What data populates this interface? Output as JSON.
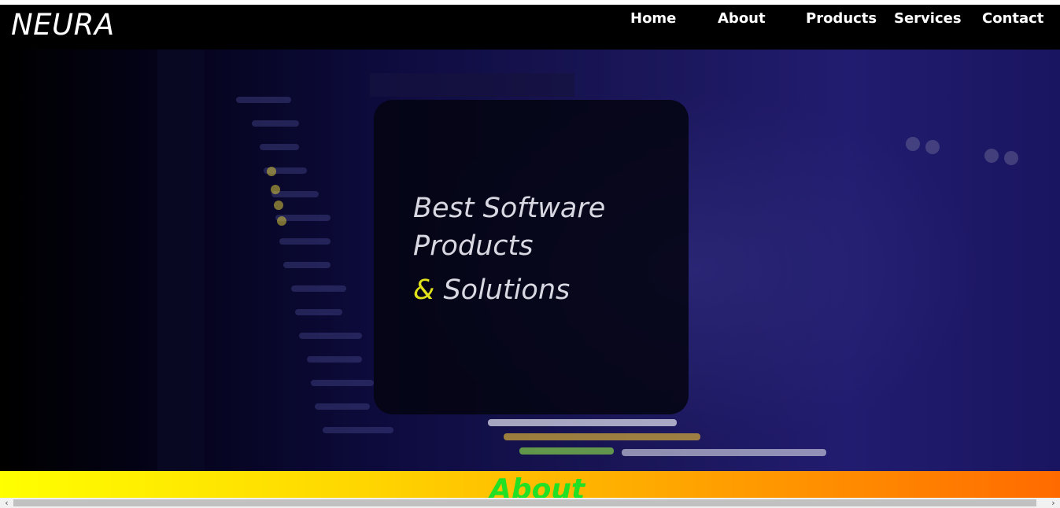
{
  "brand": {
    "name": "NEURA"
  },
  "nav": {
    "items": [
      {
        "label": "Home"
      },
      {
        "label": "About"
      },
      {
        "label": "Products"
      },
      {
        "label": "Services"
      },
      {
        "label": "Contact"
      }
    ]
  },
  "hero": {
    "line1": "Best Software",
    "line2": "Products",
    "ampersand": "&",
    "line3": "Solutions",
    "background_image": "code-editor-screen-photo"
  },
  "about_section": {
    "title": "About"
  },
  "scrollbar": {
    "left_icon": "chevron-left-icon",
    "right_icon": "chevron-right-icon"
  },
  "colors": {
    "nav_bg": "#000000",
    "accent_yellow": "#e1e21c",
    "about_title": "#22e024",
    "gradient_start": "#ffff00",
    "gradient_end": "#ff6a00"
  }
}
